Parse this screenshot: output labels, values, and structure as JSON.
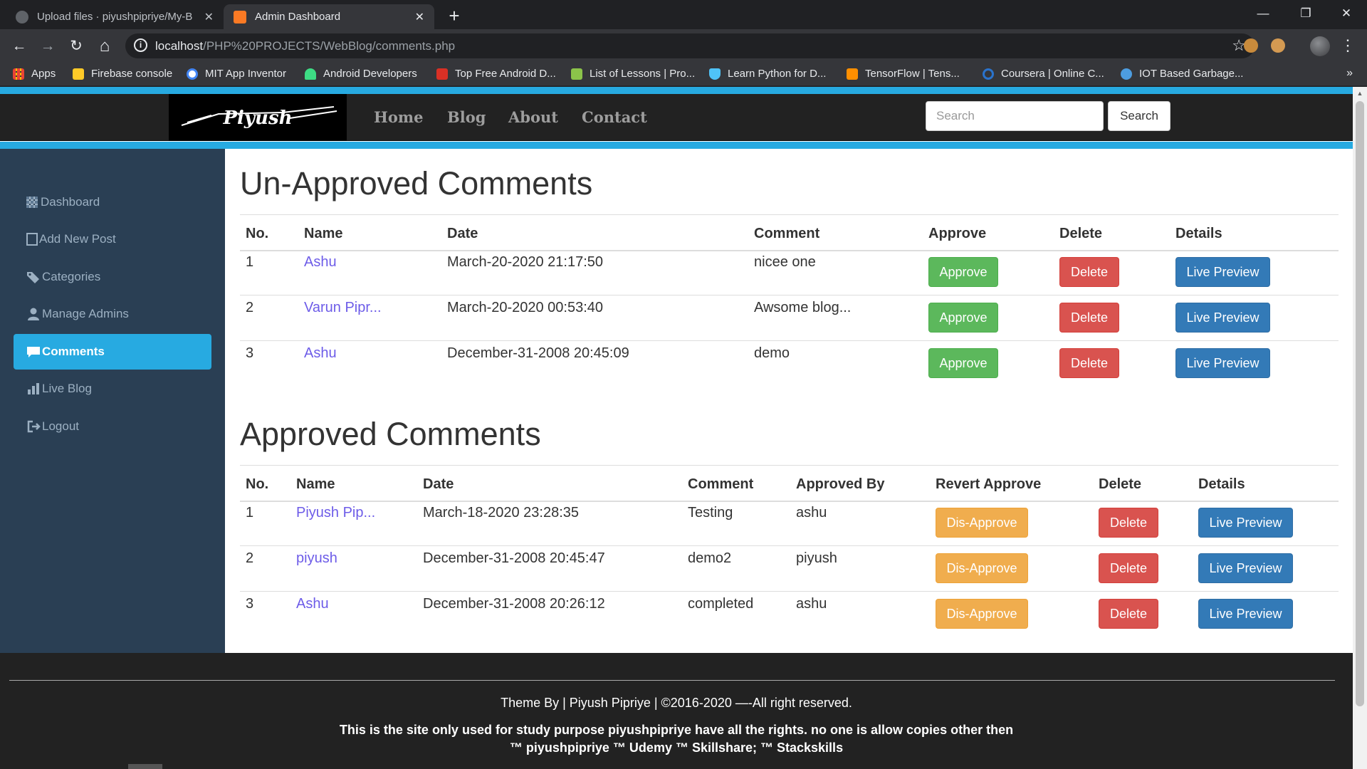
{
  "browser": {
    "tabs": [
      {
        "label": "Upload files · piyushpipriye/My-B",
        "active": false,
        "close": "✕"
      },
      {
        "label": "Admin Dashboard",
        "active": true,
        "close": "✕"
      }
    ],
    "new_tab": "+",
    "window_controls": {
      "minimize": "—",
      "restore": "❐",
      "close": "✕"
    },
    "nav": {
      "back": "←",
      "forward": "→",
      "reload": "↻",
      "home": "⌂"
    },
    "url_host": "localhost",
    "url_path": "/PHP%20PROJECTS/WebBlog/comments.php",
    "info_glyph": "i",
    "star_glyph": "☆",
    "menu_glyph": "⋮",
    "bookmarks": [
      {
        "label": "Apps",
        "color": "#e8eaed"
      },
      {
        "label": "Firebase console",
        "color": "#ffca28"
      },
      {
        "label": "MIT App Inventor",
        "color": "#4285f4"
      },
      {
        "label": "Android Developers",
        "color": "#3ddc84"
      },
      {
        "label": "Top Free Android D...",
        "color": "#d93025"
      },
      {
        "label": "List of Lessons | Pro...",
        "color": "#8bc34a"
      },
      {
        "label": "Learn Python for D...",
        "color": "#4fc3f7"
      },
      {
        "label": "TensorFlow  |  Tens...",
        "color": "#ff8f00"
      },
      {
        "label": "Coursera | Online C...",
        "color": "#2a73cc"
      },
      {
        "label": "IOT Based Garbage...",
        "color": "#4d9de0"
      }
    ],
    "bookmarks_more": "»"
  },
  "site": {
    "logo_text": "Piyush",
    "nav_links": [
      "Home",
      "Blog",
      "About",
      "Contact"
    ],
    "search_placeholder": "Search",
    "search_button": "Search"
  },
  "sidebar": {
    "items": [
      {
        "label": "Dashboard",
        "icon": "dashboard-icon",
        "active": false
      },
      {
        "label": "Add New Post",
        "icon": "add-post-icon",
        "active": false
      },
      {
        "label": "Categories",
        "icon": "tags-icon",
        "active": false
      },
      {
        "label": "Manage Admins",
        "icon": "user-icon",
        "active": false
      },
      {
        "label": "Comments",
        "icon": "comment-icon",
        "active": true
      },
      {
        "label": "Live Blog",
        "icon": "chart-icon",
        "active": false
      },
      {
        "label": "Logout",
        "icon": "logout-icon",
        "active": false
      }
    ]
  },
  "unapproved": {
    "title": "Un-Approved Comments",
    "headers": [
      "No.",
      "Name",
      "Date",
      "Comment",
      "Approve",
      "Delete",
      "Details"
    ],
    "rows": [
      {
        "no": "1",
        "name": "Ashu",
        "date": "March-20-2020 21:17:50",
        "comment": "nicee one"
      },
      {
        "no": "2",
        "name": "Varun Pipr...",
        "date": "March-20-2020 00:53:40",
        "comment": "Awsome blog..."
      },
      {
        "no": "3",
        "name": "Ashu",
        "date": "December-31-2008 20:45:09",
        "comment": "demo"
      }
    ],
    "approve_label": "Approve",
    "delete_label": "Delete",
    "details_label": "Live Preview"
  },
  "approved": {
    "title": "Approved Comments",
    "headers": [
      "No.",
      "Name",
      "Date",
      "Comment",
      "Approved By",
      "Revert Approve",
      "Delete",
      "Details"
    ],
    "rows": [
      {
        "no": "1",
        "name": "Piyush Pip...",
        "date": "March-18-2020 23:28:35",
        "comment": "Testing",
        "by": "ashu"
      },
      {
        "no": "2",
        "name": "piyush",
        "date": "December-31-2008 20:45:47",
        "comment": "demo2",
        "by": "piyush"
      },
      {
        "no": "3",
        "name": "Ashu",
        "date": "December-31-2008 20:26:12",
        "comment": "completed",
        "by": "ashu"
      }
    ],
    "revert_label": "Dis-Approve",
    "delete_label": "Delete",
    "details_label": "Live Preview"
  },
  "footer": {
    "theme": "Theme By | Piyush Pipriye | ©2016-2020 —-All right reserved.",
    "note_line1": "This is the site only used for study purpose piyushpipriye have all the rights. no one is allow copies other then",
    "note_line2": "™ piyushpipriye ™ Udemy ™ Skillshare; ™ Stackskills"
  }
}
